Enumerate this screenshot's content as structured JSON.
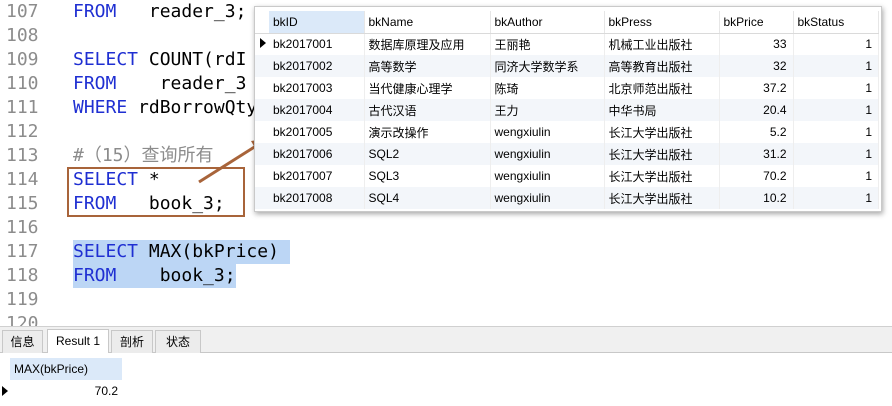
{
  "editor": {
    "lines": [
      {
        "num": "107",
        "parts": [
          {
            "t": "FROM",
            "c": "kw"
          },
          {
            "t": "   reader_3;",
            "c": "tx"
          }
        ]
      },
      {
        "num": "108",
        "parts": []
      },
      {
        "num": "109",
        "parts": [
          {
            "t": "SELECT",
            "c": "kw"
          },
          {
            "t": " COUNT(rdI",
            "c": "tx"
          }
        ]
      },
      {
        "num": "110",
        "parts": [
          {
            "t": "FROM",
            "c": "kw"
          },
          {
            "t": "    reader_3",
            "c": "tx"
          }
        ]
      },
      {
        "num": "111",
        "parts": [
          {
            "t": "WHERE",
            "c": "kw"
          },
          {
            "t": " rdBorrowQty",
            "c": "tx"
          }
        ]
      },
      {
        "num": "112",
        "parts": []
      },
      {
        "num": "113",
        "parts": [
          {
            "t": "#（15）查询所有",
            "c": "cm"
          }
        ]
      },
      {
        "num": "114",
        "parts": [
          {
            "t": "SELECT",
            "c": "kw"
          },
          {
            "t": " *",
            "c": "tx"
          }
        ]
      },
      {
        "num": "115",
        "parts": [
          {
            "t": "FROM",
            "c": "kw"
          },
          {
            "t": "   book_3;",
            "c": "tx"
          }
        ]
      },
      {
        "num": "116",
        "parts": []
      },
      {
        "num": "117",
        "parts": [
          {
            "t": "SELECT",
            "c": "kw"
          },
          {
            "t": " MAX(bkPrice) ",
            "c": "tx"
          }
        ],
        "highlight": true
      },
      {
        "num": "118",
        "parts": [
          {
            "t": "FROM",
            "c": "kw"
          },
          {
            "t": "    book_3;",
            "c": "tx"
          }
        ],
        "highlight": true
      },
      {
        "num": "119",
        "parts": []
      },
      {
        "num": "120",
        "parts": []
      }
    ]
  },
  "popup": {
    "columns": [
      "bkID",
      "bkName",
      "bkAuthor",
      "bkPress",
      "bkPrice",
      "bkStatus"
    ],
    "rows": [
      [
        "bk2017001",
        "数据库原理及应用",
        "王丽艳",
        "机械工业出版社",
        "33",
        "1"
      ],
      [
        "bk2017002",
        "高等数学",
        "同济大学数学系",
        "高等教育出版社",
        "32",
        "1"
      ],
      [
        "bk2017003",
        "当代健康心理学",
        "陈琦",
        "北京师范出版社",
        "37.2",
        "1"
      ],
      [
        "bk2017004",
        "古代汉语",
        "王力",
        "中华书局",
        "20.4",
        "1"
      ],
      [
        "bk2017005",
        "演示改操作",
        "wengxiulin",
        "长江大学出版社",
        "5.2",
        "1"
      ],
      [
        "bk2017006",
        "SQL2",
        "wengxiulin",
        "长江大学出版社",
        "31.2",
        "1"
      ],
      [
        "bk2017007",
        "SQL3",
        "wengxiulin",
        "长江大学出版社",
        "70.2",
        "1"
      ],
      [
        "bk2017008",
        "SQL4",
        "wengxiulin",
        "长江大学出版社",
        "10.2",
        "1"
      ]
    ]
  },
  "tabs": [
    {
      "label": "信息",
      "active": false
    },
    {
      "label": "Result 1",
      "active": true
    },
    {
      "label": "剖析",
      "active": false
    },
    {
      "label": "状态",
      "active": false
    }
  ],
  "result": {
    "column": "MAX(bkPrice)",
    "value": "70.2"
  },
  "colors": {
    "keyword": "#1f2fd2",
    "selection": "#bcd6f5",
    "annotation": "#a8643a",
    "header_highlight": "#dbe9f9"
  }
}
